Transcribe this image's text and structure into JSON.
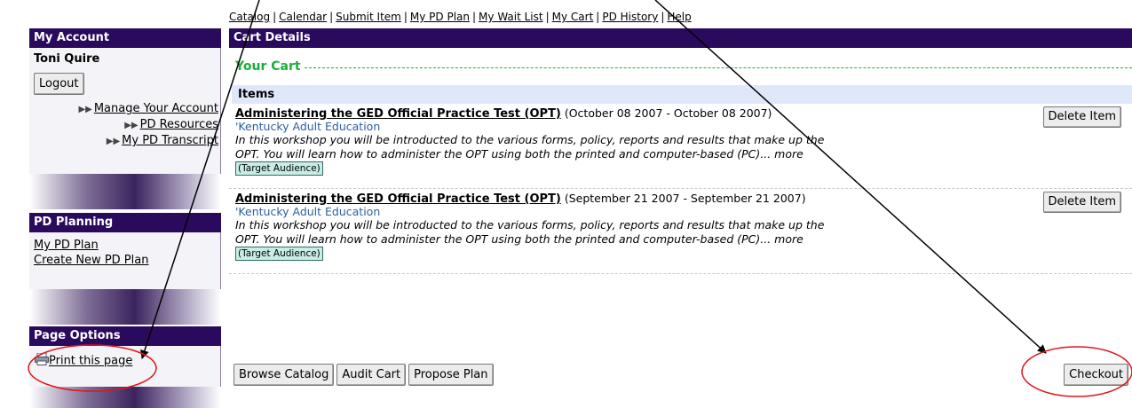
{
  "topnav": {
    "links": [
      "Catalog",
      "Calendar",
      "Submit Item",
      "My PD Plan",
      "My Wait List",
      "My Cart",
      "PD History",
      "Help"
    ],
    "separator": "|"
  },
  "sidebar": {
    "account": {
      "title": "My Account",
      "user": "Toni Quire",
      "logout": "Logout",
      "links": [
        "Manage Your Account",
        "PD Resources",
        "My PD Transcript"
      ]
    },
    "planning": {
      "title": "PD Planning",
      "links": [
        "My PD Plan",
        "Create New PD Plan"
      ]
    },
    "options": {
      "title": "Page Options",
      "print": "Print this page"
    }
  },
  "main": {
    "header": "Cart Details",
    "cart_title": "Your Cart",
    "items_header": "Items",
    "items": [
      {
        "title": "Administering the GED Official Practice Test (OPT)",
        "dates": "(October 08 2007 - October 08 2007)",
        "org": "'Kentucky Adult Education",
        "description": "In this workshop you will be introducted to the various forms, policy, reports and results that make up the OPT. You will learn how to administer the OPT using both the printed and computer-based (PC)... more",
        "badge": "(Target Audience)",
        "delete": "Delete Item"
      },
      {
        "title": "Administering the GED Official Practice Test (OPT)",
        "dates": "(September 21 2007 - September 21 2007)",
        "org": "'Kentucky Adult Education",
        "description": "In this workshop you will be introducted to the various forms, policy, reports and results that make up the OPT. You will learn how to administer the OPT using both the printed and computer-based (PC)... more",
        "badge": "(Target Audience)",
        "delete": "Delete Item"
      }
    ],
    "buttons": [
      "Browse Catalog",
      "Audit Cart",
      "Propose Plan"
    ],
    "checkout": "Checkout"
  },
  "colors": {
    "header_bg": "#2a0a5c",
    "cart_title": "#1cae3a",
    "items_header_bg": "#dfe7fb",
    "org_link": "#2c5da3",
    "annotation_red": "#e0151b"
  }
}
